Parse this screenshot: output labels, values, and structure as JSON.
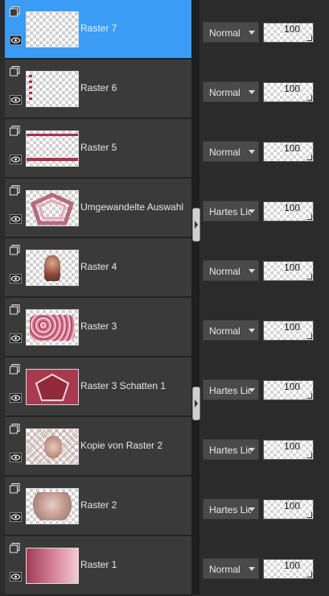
{
  "layers": [
    {
      "name": "Raster 7",
      "blend": "Normal",
      "opacity": "100",
      "selected": true,
      "thumb": "transparent-dots"
    },
    {
      "name": "Raster 6",
      "blend": "Normal",
      "opacity": "100",
      "selected": false,
      "thumb": "left-strip"
    },
    {
      "name": "Raster 5",
      "blend": "Normal",
      "opacity": "100",
      "selected": false,
      "thumb": "frame-lines"
    },
    {
      "name": "Umgewandelte Auswahl",
      "blend": "Hartes Licht",
      "opacity": "100",
      "selected": false,
      "thumb": "pentagon-frame"
    },
    {
      "name": "Raster 4",
      "blend": "Normal",
      "opacity": "100",
      "selected": false,
      "thumb": "figure"
    },
    {
      "name": "Raster 3",
      "blend": "Normal",
      "opacity": "100",
      "selected": false,
      "thumb": "pink-pattern"
    },
    {
      "name": "Raster 3 Schatten 1",
      "blend": "Hartes Licht",
      "opacity": "100",
      "selected": false,
      "thumb": "red-pentagon"
    },
    {
      "name": "Kopie von Raster 2",
      "blend": "Hartes Licht",
      "opacity": "100",
      "selected": false,
      "thumb": "lattice-figure"
    },
    {
      "name": "Raster 2",
      "blend": "Hartes Licht",
      "opacity": "100",
      "selected": false,
      "thumb": "figure-soft"
    },
    {
      "name": "Raster 1",
      "blend": "Normal",
      "opacity": "100",
      "selected": false,
      "thumb": "gradient"
    }
  ],
  "colors": {
    "selected": "#3a9cf5",
    "row": "#3a3a3a",
    "accent_red": "#a8324a",
    "pink": "#e6a7b8"
  },
  "icons": {
    "visibility": "eye-icon",
    "layer_type": "raster-layer-icon"
  }
}
